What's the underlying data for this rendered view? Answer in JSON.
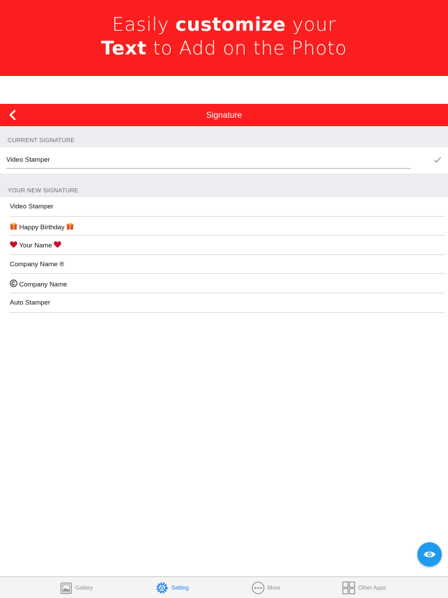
{
  "promo": {
    "line1_pre": "Easily ",
    "line1_bold": "customize",
    "line1_post": " your",
    "line2_bold": "Text",
    "line2_post": " to Add on the Photo"
  },
  "navbar": {
    "title": "Signature",
    "back_icon": "chevron-left-icon"
  },
  "current_section": {
    "header": "CURRENT SIGNATURE",
    "value": "Video Stamper",
    "check_icon": "checkmark-icon"
  },
  "new_section": {
    "header": "YOUR NEW SIGNATURE",
    "items": [
      {
        "label": "Video Stamper"
      },
      {
        "label": "Happy Birthday",
        "icon": "gift-icon"
      },
      {
        "label": "Your Name",
        "icon": "heart-icon"
      },
      {
        "label": "Company Name ®"
      },
      {
        "label": "Company Name",
        "icon": "copyright-icon"
      },
      {
        "label": "Auto Stamper"
      }
    ]
  },
  "fab": {
    "icon": "eye-icon"
  },
  "tabbar": {
    "items": [
      {
        "label": "Gallery",
        "icon": "gallery-icon"
      },
      {
        "label": "Setting",
        "icon": "gear-icon",
        "active": true
      },
      {
        "label": "More",
        "icon": "more-dots-icon"
      },
      {
        "label": "Other Apps",
        "icon": "grid-icon"
      }
    ]
  },
  "colors": {
    "brand_red": "#fb1e1e",
    "accent_blue": "#1e9bf0",
    "active_tab": "#1e7ff0"
  }
}
